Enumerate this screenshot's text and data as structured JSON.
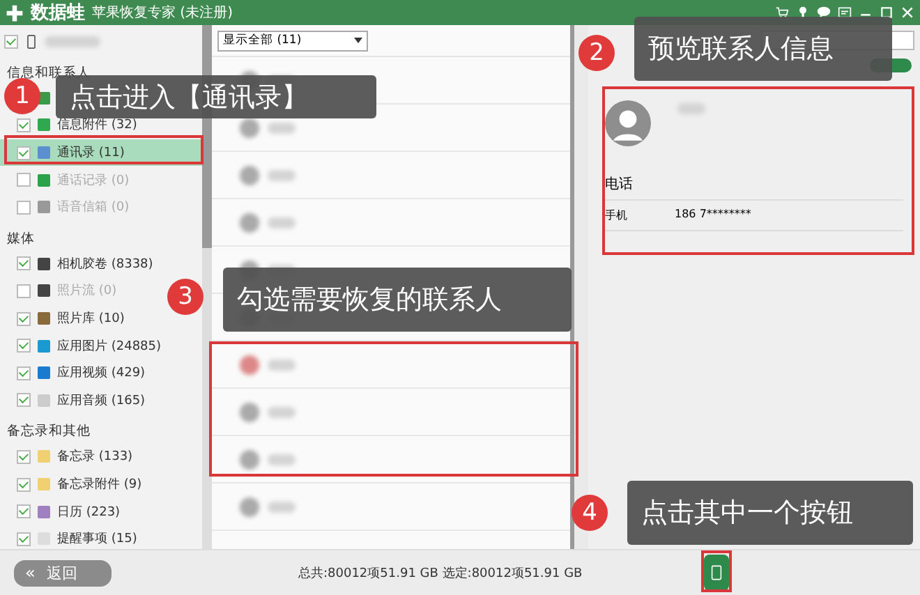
{
  "window": {
    "logo": "数据蛙",
    "title": "苹果恢复专家 (未注册)"
  },
  "device": {
    "checked": true
  },
  "sidebar": {
    "sections": [
      {
        "title": "信息和联系人",
        "items": [
          {
            "selected": false
          },
          {
            "label": "信息附件 (32)",
            "checked": true,
            "selected": false,
            "disabled": false
          },
          {
            "label": "通讯录 (11)",
            "checked": true,
            "selected": true,
            "disabled": false
          },
          {
            "label": "通话记录 (0)",
            "checked": false,
            "selected": false,
            "disabled": true
          },
          {
            "label": "语音信箱 (0)",
            "checked": false,
            "selected": false,
            "disabled": true
          }
        ]
      },
      {
        "title": "媒体",
        "items": [
          {
            "label": "相机胶卷 (8338)",
            "checked": true,
            "selected": false,
            "disabled": false
          },
          {
            "label": "照片流 (0)",
            "checked": false,
            "selected": false,
            "disabled": true
          },
          {
            "label": "照片库 (10)",
            "checked": true,
            "selected": false,
            "disabled": false
          },
          {
            "label": "应用图片 (24885)",
            "checked": true,
            "selected": false,
            "disabled": false
          },
          {
            "label": "应用视频 (429)",
            "checked": true,
            "selected": false,
            "disabled": false
          },
          {
            "label": "应用音频 (165)",
            "checked": true,
            "selected": false,
            "disabled": false
          }
        ]
      },
      {
        "title": "备忘录和其他",
        "items": [
          {
            "label": "备忘录 (133)",
            "checked": true,
            "selected": false,
            "disabled": false
          },
          {
            "label": "备忘录附件 (9)",
            "checked": true,
            "selected": false,
            "disabled": false
          },
          {
            "label": "日历 (223)",
            "checked": true,
            "selected": false,
            "disabled": false
          },
          {
            "label": "提醒事项 (15)",
            "checked": true,
            "selected": false,
            "disabled": false
          }
        ]
      }
    ]
  },
  "list": {
    "filter": "显示全部 (11)"
  },
  "contact": {
    "section": "电话",
    "fields": [
      {
        "label": "手机",
        "value": "186 7********"
      }
    ]
  },
  "footer": {
    "back_icon": "«",
    "back": "返回",
    "status": "总共:80012项51.91 GB 选定:80012项51.91 GB"
  },
  "annotations": [
    {
      "number": "1",
      "text": "点击进入【通讯录】"
    },
    {
      "number": "2",
      "text": "预览联系人信息"
    },
    {
      "number": "3",
      "text": "勾选需要恢复的联系人"
    },
    {
      "number": "4",
      "text": "点击其中一个按钮"
    }
  ]
}
